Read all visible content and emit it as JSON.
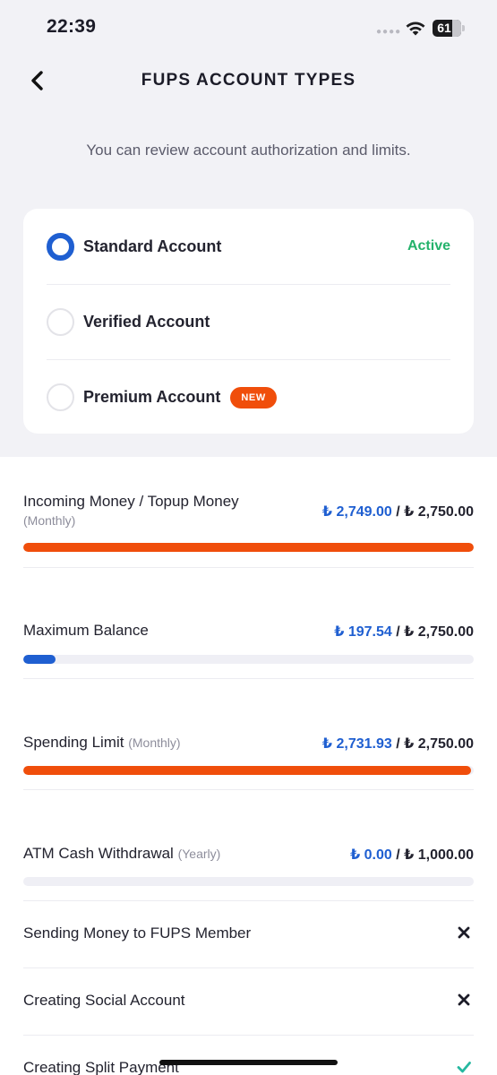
{
  "status_bar": {
    "time": "22:39",
    "battery": "61"
  },
  "nav": {
    "title": "FUPS ACCOUNT TYPES"
  },
  "subtitle": "You can review account authorization and limits.",
  "accounts": [
    {
      "label": "Standard Account",
      "selected": true,
      "status": "Active"
    },
    {
      "label": "Verified Account",
      "selected": false
    },
    {
      "label": "Premium Account",
      "selected": false,
      "badge": "NEW"
    }
  ],
  "limits": [
    {
      "label": "Incoming Money / Topup Money",
      "period": "(Monthly)",
      "used": "₺ 2,749.00",
      "separator": "/",
      "max": "₺ 2,750.00",
      "progress": 0.9996,
      "color": "#f04e0b"
    },
    {
      "label": "Maximum Balance",
      "period": "",
      "used": "₺ 197.54",
      "separator": "/",
      "max": "₺ 2,750.00",
      "progress": 0.0718,
      "color": "#1f5fd1"
    },
    {
      "label": "Spending Limit",
      "period": "(Monthly)",
      "used": "₺ 2,731.93",
      "separator": "/",
      "max": "₺ 2,750.00",
      "progress": 0.9934,
      "color": "#f04e0b"
    },
    {
      "label": "ATM Cash Withdrawal",
      "period": "(Yearly)",
      "used": "₺ 0.00",
      "separator": "/",
      "max": "₺ 1,000.00",
      "progress": 0,
      "color": "#1f5fd1"
    }
  ],
  "permissions": [
    {
      "label": "Sending Money to FUPS Member",
      "allowed": false,
      "icon": "close-icon"
    },
    {
      "label": "Creating Social Account",
      "allowed": false,
      "icon": "close-icon"
    },
    {
      "label": "Creating Split Payment",
      "allowed": true,
      "icon": "check-icon"
    }
  ],
  "colors": {
    "accent": "#1f5fd1",
    "warning": "#f04e0b",
    "active": "#24b26b",
    "check": "#26b8a0"
  }
}
